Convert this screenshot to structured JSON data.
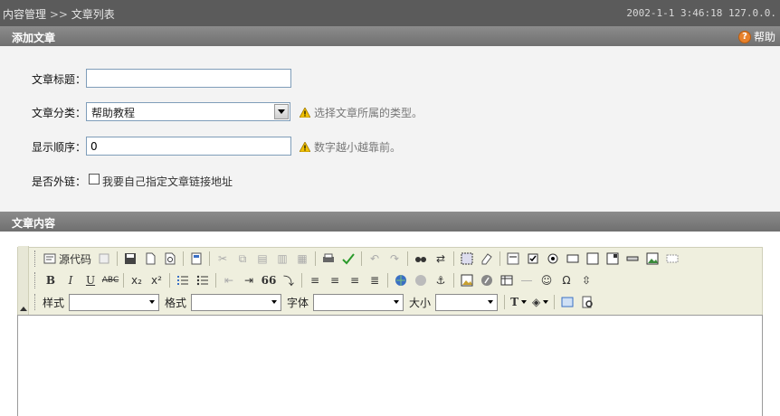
{
  "topbar": {
    "crumb_parent": "内容管理",
    "crumb_sep": ">>",
    "crumb_current": "文章列表",
    "status": "2002-1-1 3:46:18 127.0.0."
  },
  "add_section": {
    "title": "添加文章",
    "help_label": "帮助",
    "help_icon_glyph": "?"
  },
  "form": {
    "title_label": "文章标题：",
    "title_value": "",
    "category_label": "文章分类：",
    "category_value": "帮助教程",
    "category_hint": "选择文章所属的类型。",
    "order_label": "显示顺序：",
    "order_value": "0",
    "order_hint": "数字越小越靠前。",
    "external_label": "是否外链：",
    "external_checkbox_label": "我要自己指定文章链接地址",
    "external_checked": false
  },
  "content_section": {
    "title": "文章内容"
  },
  "editor": {
    "source_label": "源代码",
    "style_label": "样式",
    "format_label": "格式",
    "font_label": "字体",
    "size_label": "大小",
    "style_value": "",
    "format_value": "",
    "font_value": "",
    "size_value": "",
    "bold_glyph": "B",
    "italic_glyph": "I",
    "underline_glyph": "U",
    "strike_glyph": "ABC",
    "subscript_glyph": "x₂",
    "superscript_glyph": "x²",
    "quote_glyph": "66",
    "textcolor_glyph": "T"
  },
  "colors": {
    "topbar_bg": "#5b5b5b",
    "section_bar": "#7d7d7d",
    "hint_warn": "#e8b400",
    "help_accent": "#e8822c"
  }
}
